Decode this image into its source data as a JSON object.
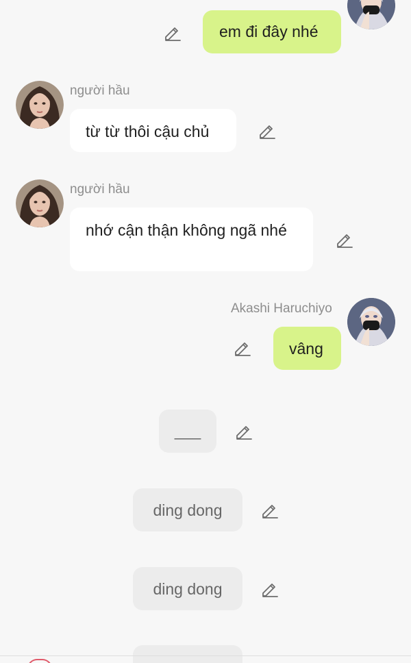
{
  "messages": [
    {
      "role": "user",
      "text": "em đi đây nhé"
    },
    {
      "role": "npc",
      "sender": "người hầu",
      "text": "từ từ thôi cậu chủ"
    },
    {
      "role": "npc",
      "sender": "người hầu",
      "text": "nhớ cận thận không ngã nhé"
    },
    {
      "role": "user",
      "sender": "Akashi Haruchiyo",
      "text": "vâng"
    },
    {
      "role": "system",
      "text": "___"
    },
    {
      "role": "system",
      "text": "ding dong"
    },
    {
      "role": "system",
      "text": "ding dong"
    }
  ],
  "icons": {
    "edit": "pencil-edit-icon",
    "npc_avatar": "woman-long-dark-hair-avatar",
    "user_avatar": "masked-boy-avatar"
  },
  "colors": {
    "background": "#f7f7f7",
    "npc_bubble": "#ffffff",
    "user_bubble": "#d8f38a",
    "system_bubble": "#ececec",
    "sender_name": "#8d8d8d"
  }
}
